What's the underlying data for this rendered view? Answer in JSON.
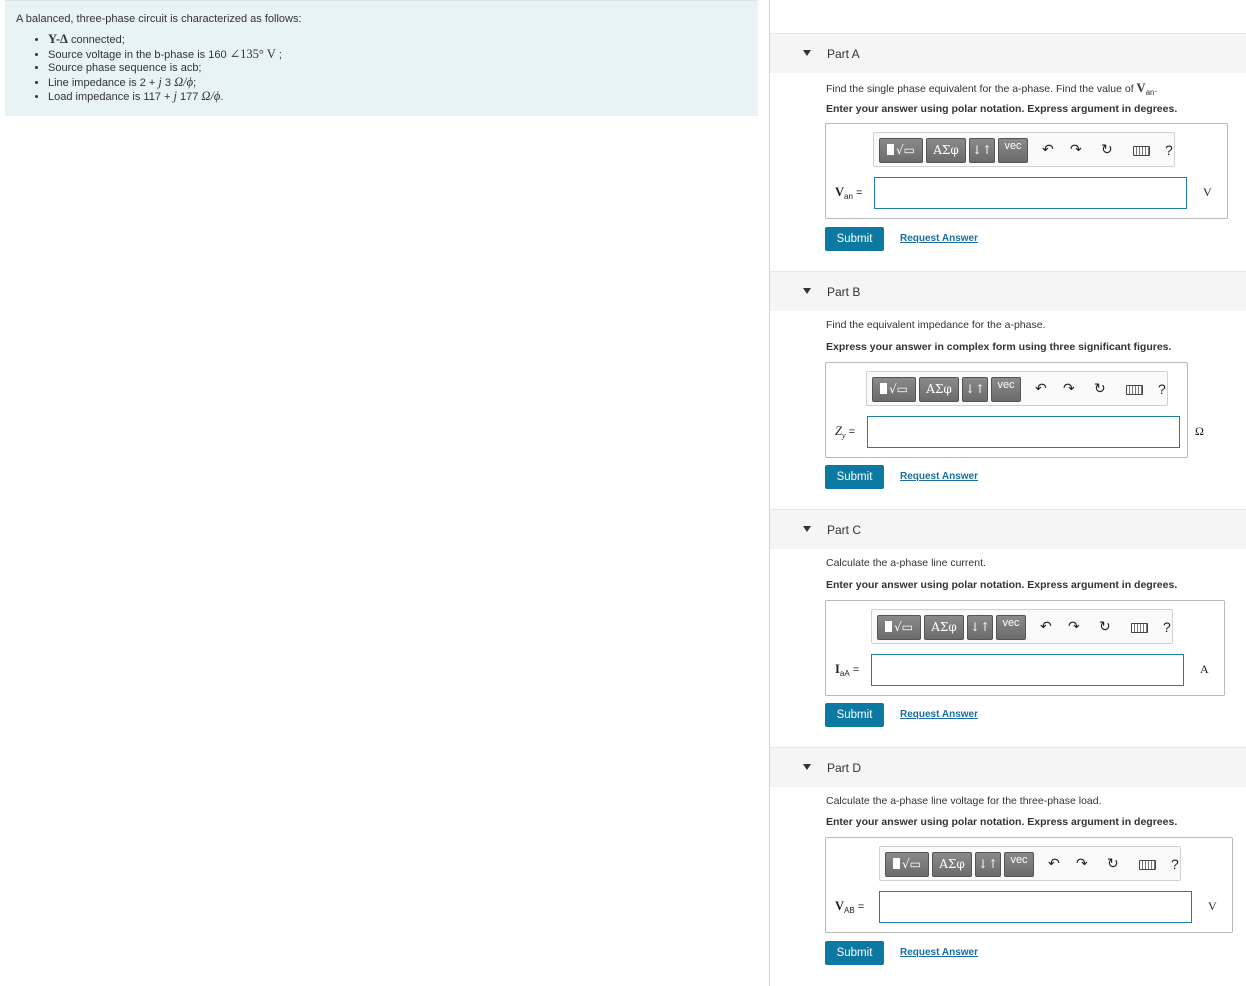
{
  "problem": {
    "intro": "A balanced, three-phase circuit is characterized as follows:",
    "items": [
      {
        "math": "Y-Δ",
        "text": " connected;"
      },
      {
        "text": "Source voltage in the b-phase is 160 ",
        "math": "∠135°  V",
        "after": " ;"
      },
      {
        "text": "Source phase sequence is acb;"
      },
      {
        "text": "Line impedance is 2 + ",
        "j": "j",
        "num": " 3 ",
        "unit": "Ω/ϕ",
        "after": ";"
      },
      {
        "text": "Load impedance is 117 + ",
        "j": "j",
        "num": " 177 ",
        "unit": "Ω/ϕ",
        "after": "."
      }
    ]
  },
  "toolbar": {
    "templates_icon": "sqrt-template-icon",
    "greek_label": "ΑΣφ",
    "arrows_label": "↓↑",
    "vec_label": "vec",
    "undo_icon": "↶",
    "redo_icon": "↷",
    "reset_icon": "↻",
    "help_label": "?"
  },
  "buttons": {
    "submit": "Submit",
    "request_answer": "Request Answer"
  },
  "parts": [
    {
      "title": "Part A",
      "question_pre": "Find the single phase equivalent for the a-phase. Find the value of ",
      "question_var": "V",
      "question_sub": "an",
      "question_post": ".",
      "instruction": "Enter your answer using polar notation. Express argument in degrees.",
      "label_main": "V",
      "label_sub": "an",
      "label_eq": " =",
      "unit": "V",
      "value": ""
    },
    {
      "title": "Part B",
      "question_pre": "Find the equivalent impedance for the a-phase.",
      "instruction": "Express your answer in complex form using three significant figures.",
      "label_main": "Z",
      "label_sub": "y",
      "label_eq": " =",
      "unit": "Ω",
      "value": ""
    },
    {
      "title": "Part C",
      "question_pre": "Calculate the a-phase line current.",
      "instruction": "Enter your answer using polar notation. Express argument in degrees.",
      "label_main": "I",
      "label_sub": "aA",
      "label_eq": " =",
      "unit": "A",
      "value": ""
    },
    {
      "title": "Part D",
      "question_pre": "Calculate the a-phase line voltage for the three-phase load.",
      "instruction": "Enter your answer using polar notation. Express argument in degrees.",
      "label_main": "V",
      "label_sub": "AB",
      "label_eq": " =",
      "unit": "V",
      "value": ""
    }
  ]
}
